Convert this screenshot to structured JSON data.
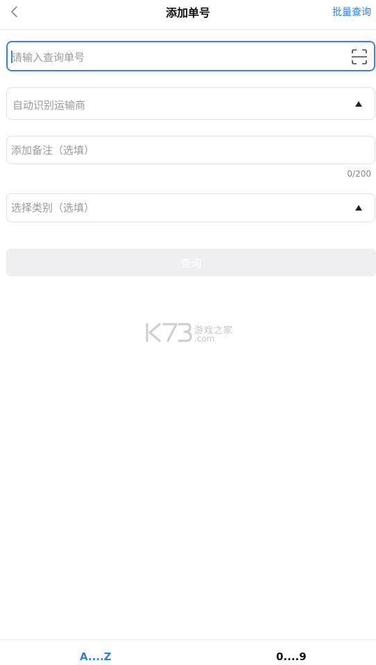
{
  "header": {
    "back_icon": "chevron-left-icon",
    "title": "添加单号",
    "batch_link": "批量查询"
  },
  "form": {
    "tracking_number": {
      "value": "",
      "placeholder": "请输入查询单号",
      "scan_icon": "scan-icon"
    },
    "carrier": {
      "placeholder": "自动识别运输商",
      "dropdown_icon": "triangle-up-icon"
    },
    "note": {
      "placeholder": "添加备注（选填）",
      "counter": "0/200"
    },
    "category": {
      "placeholder": "选择类别（选填）",
      "dropdown_icon": "triangle-up-icon"
    },
    "query_button": "查询"
  },
  "watermark": {
    "brand": "K73",
    "site_cn": "游戏之家",
    "domain": ".com"
  },
  "bottom_tabs": [
    {
      "label": "A....Z",
      "active": true
    },
    {
      "label": "0....9",
      "active": false
    }
  ],
  "colors": {
    "accent": "#2f7fd8",
    "field_focus_border": "#3b82d6",
    "disabled_button": "#efeff1"
  }
}
